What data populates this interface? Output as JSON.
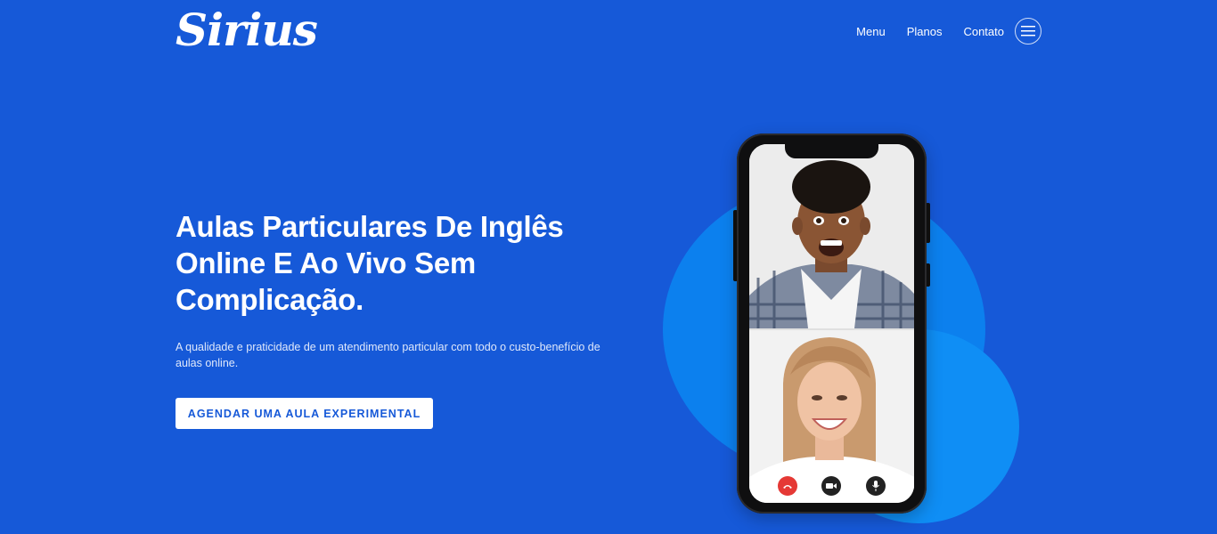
{
  "brand": {
    "name": "Sirius"
  },
  "nav": {
    "items": [
      {
        "label": "Menu"
      },
      {
        "label": "Planos"
      },
      {
        "label": "Contato"
      }
    ],
    "menu_icon": "hamburger-icon"
  },
  "hero": {
    "title": "Aulas Particulares De Inglês Online E Ao Vivo Sem Complicação.",
    "subtitle": "A qualidade e praticidade de um atendimento particular com todo o custo-benefício de aulas online.",
    "cta_label": "AGENDAR UMA AULA EXPERIMENTAL"
  },
  "illustration": {
    "call_controls": [
      {
        "icon": "hang-up-icon",
        "color": "#e53935"
      },
      {
        "icon": "video-camera-icon",
        "color": "#222222"
      },
      {
        "icon": "microphone-icon",
        "color": "#222222"
      }
    ]
  },
  "colors": {
    "background": "#1659d8",
    "blob": "#0c80ee",
    "cta_text": "#1659d8"
  }
}
